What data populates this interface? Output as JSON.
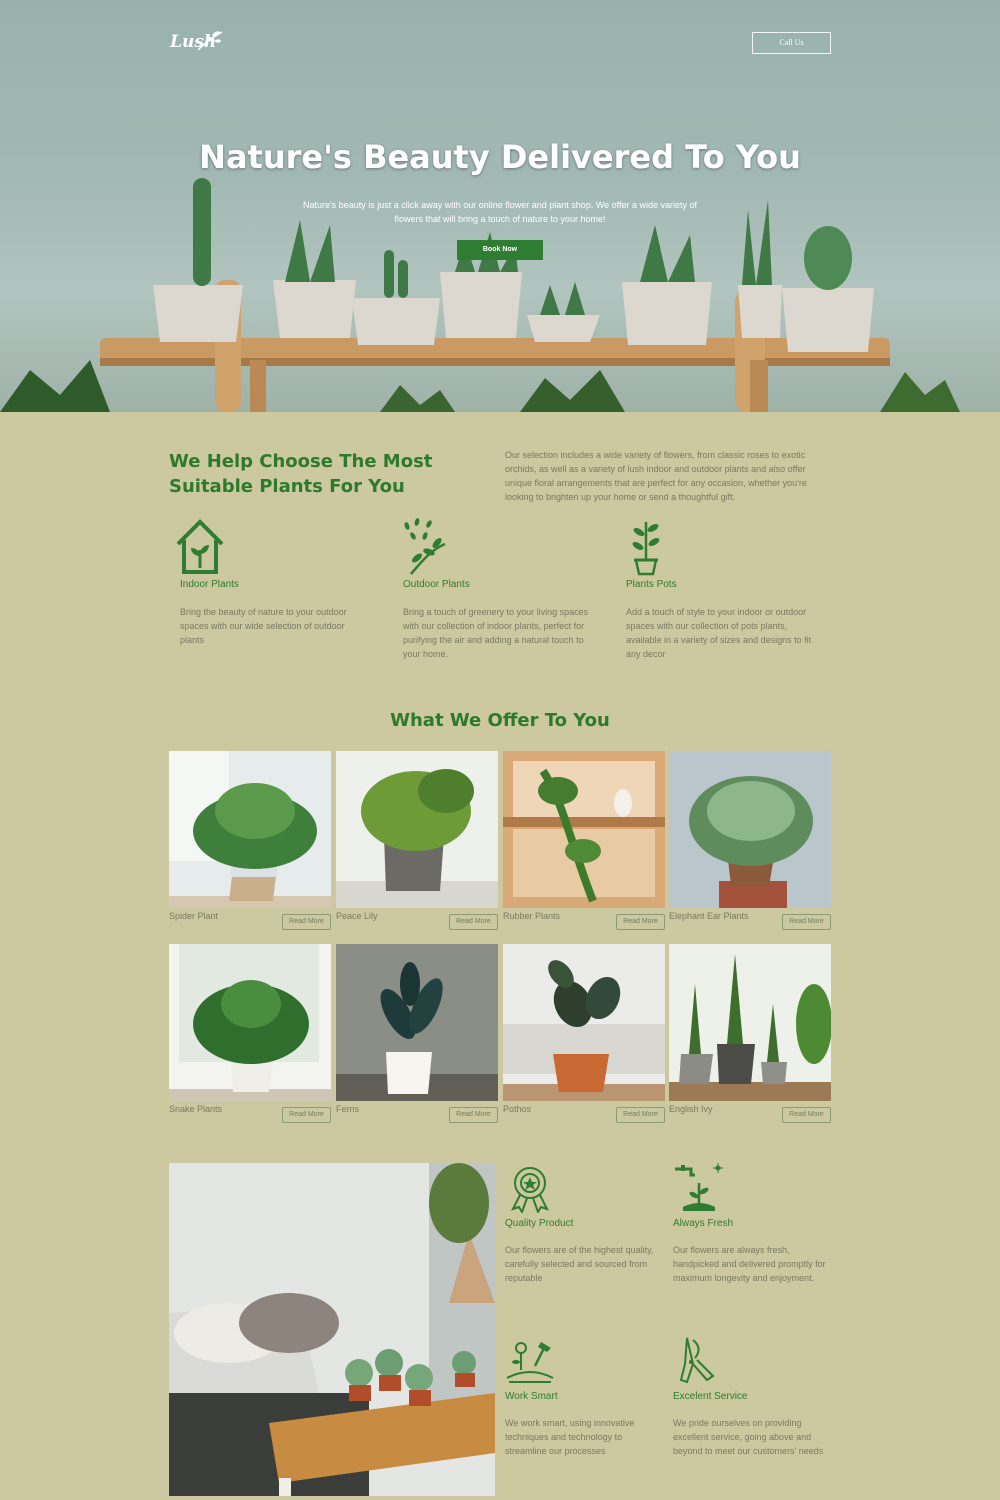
{
  "header": {
    "logo": "Lush",
    "call_label": "Call Us"
  },
  "hero": {
    "title": "Nature's Beauty Delivered To You",
    "subtitle": "Nature's beauty is just a click away with our online flower and plant shop. We offer a wide variety of flowers that will bring a touch of nature to your home!",
    "cta": "Book Now"
  },
  "help": {
    "title": "We Help Choose The Most Suitable Plants For You",
    "text": "Our selection includes a wide variety of flowers, from classic roses to exotic orchids, as well as a variety of lush indoor and outdoor plants and also offer unique floral arrangements that are perfect for any occasion, whether you're looking to brighten up your home or send a thoughtful gift.",
    "features": [
      {
        "icon": "house-plant-icon",
        "title": "Indoor Plants",
        "desc": "Bring the beauty of nature to your outdoor spaces with our wide selection of outdoor plants"
      },
      {
        "icon": "sprouts-icon",
        "title": "Outdoor Plants",
        "desc": "Bring a touch of greenery to your living spaces with our collection of indoor plants, perfect for purifying the air and adding a natural touch to your home."
      },
      {
        "icon": "potted-plant-icon",
        "title": "Plants Pots",
        "desc": "Add a touch of style to your indoor or outdoor spaces with our collection of pots plants, available in a variety of sizes and designs to fit any decor"
      }
    ]
  },
  "offer": {
    "title": "What We Offer To You",
    "read_more": "Read More",
    "items": [
      {
        "name": "Spider Plant"
      },
      {
        "name": "Peace Lily"
      },
      {
        "name": "Rubber Plants"
      },
      {
        "name": "Elephant Ear Plants"
      },
      {
        "name": "Snake Plants"
      },
      {
        "name": "Ferns"
      },
      {
        "name": "Pothos"
      },
      {
        "name": "English Ivy"
      }
    ]
  },
  "why": [
    {
      "icon": "award-badge-icon",
      "title": "Quality Product",
      "desc": "Our flowers are of the highest quality, carefully selected and sourced from reputable"
    },
    {
      "icon": "watering-sprout-icon",
      "title": "Always Fresh",
      "desc": "Our flowers are always fresh, handpicked and delivered promptly for maximum longevity and enjoyment."
    },
    {
      "icon": "garden-tools-icon",
      "title": "Work Smart",
      "desc": "We work smart, using innovative techniques and technology to streamline our processes"
    },
    {
      "icon": "pruning-shears-icon",
      "title": "Excelent Service",
      "desc": "We pride ourselves on providing excellent service, going above and beyond to meet our customers' needs"
    }
  ],
  "colors": {
    "accent": "#2e7d32",
    "background": "#ccc89f"
  }
}
